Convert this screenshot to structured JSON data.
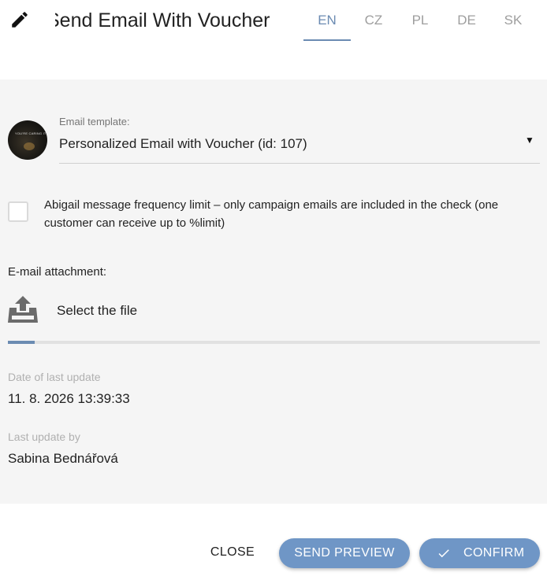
{
  "header": {
    "title": "Send Email With Voucher",
    "tabs": [
      "EN",
      "CZ",
      "PL",
      "DE",
      "SK"
    ],
    "active_tab": "EN"
  },
  "template_select": {
    "label": "Email template:",
    "value": "Personalized Email with Voucher (id: 107)",
    "avatar_text": "YOU'RE CARING IT"
  },
  "frequency_limit": {
    "checked": false,
    "text": "Abigail message frequency limit – only campaign emails are included in the check (one customer can receive up to %limit)"
  },
  "attachment": {
    "label": "E-mail attachment:",
    "select_label": "Select the file",
    "progress": 0.05
  },
  "meta": {
    "last_update_label": "Date of last update",
    "last_update_value": "11. 8. 2026 13:39:33",
    "last_update_by_label": "Last update by",
    "last_update_by_value": "Sabina Bednářová"
  },
  "footer": {
    "close_label": "CLOSE",
    "preview_label": "SEND PREVIEW",
    "confirm_label": "CONFIRM"
  },
  "colors": {
    "accent": "#6b8bb2",
    "button": "#6f96c6",
    "panel": "#f5f5f5"
  }
}
